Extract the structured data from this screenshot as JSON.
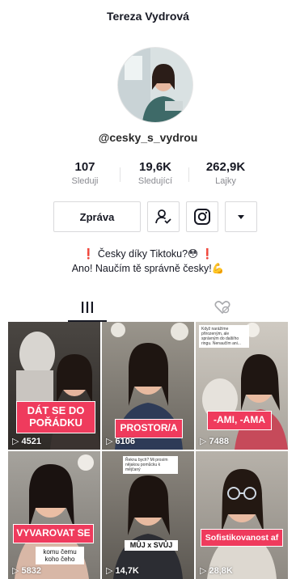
{
  "profile": {
    "name": "Tereza Vydrová",
    "handle": "@cesky_s_vydrou",
    "stats": [
      {
        "value": "107",
        "label": "Sleduji"
      },
      {
        "value": "19,6K",
        "label": "Sledující"
      },
      {
        "value": "262,9K",
        "label": "Lajky"
      }
    ],
    "message_button": "Zpráva",
    "bio_line1": "❗ Česky díky Tiktoku?😳 ❗",
    "bio_line2": "Ano! Naučím tě správně česky!💪"
  },
  "tabs": [
    {
      "name": "videos",
      "icon": "grid-bars-icon",
      "active": true
    },
    {
      "name": "liked",
      "icon": "heart-hidden-icon",
      "active": false
    }
  ],
  "videos": [
    {
      "caption": "DÁT SE DO POŘÁDKU",
      "views": "4521"
    },
    {
      "caption": "PROSTOR/A",
      "views": "6106"
    },
    {
      "caption": "-AMI, -AMA",
      "views": "7488",
      "note": "Když narážíme přirozeným, ale správným do dalšího ringu. Nenaučím ani..."
    },
    {
      "caption": "VYVAROVAT SE",
      "views": "5832",
      "subcaption": "komu čemu koho čeho"
    },
    {
      "caption": "MŮJ x SVŮJ",
      "views": "14,7K",
      "note": "Řeknu bych? Mi prosím nějakou pomůcku k mějčaný"
    },
    {
      "caption": "Sofistikovanost af",
      "views": "28,8K"
    }
  ]
}
